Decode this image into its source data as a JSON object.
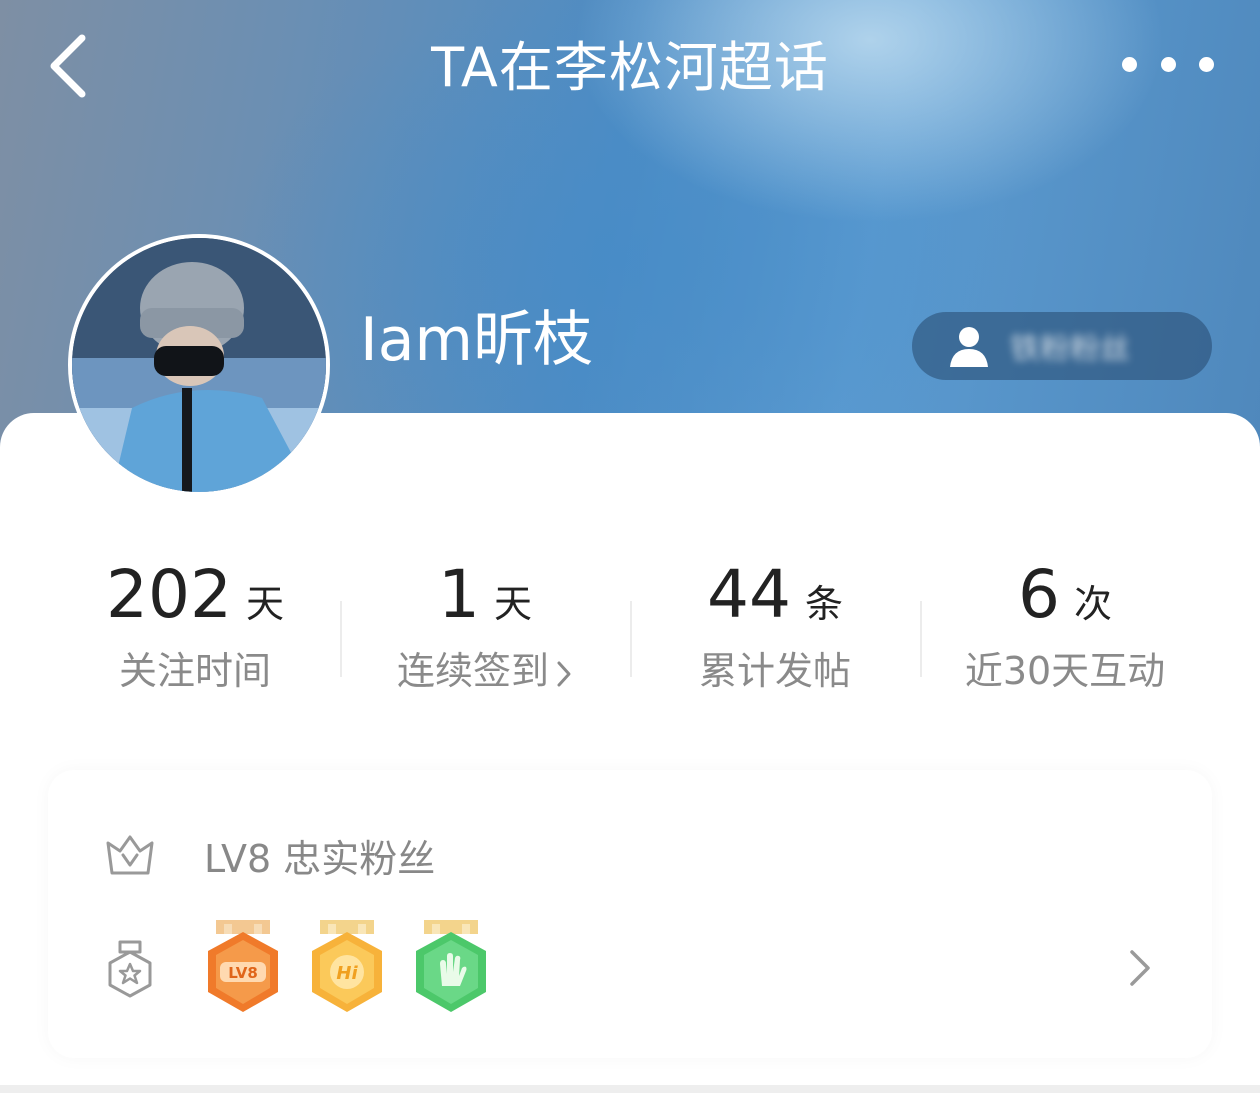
{
  "header": {
    "title": "TA在李松河超话",
    "back_icon": "chevron-left-icon",
    "more_icon": "more-dots-icon"
  },
  "profile": {
    "username": "Iam昕枝",
    "fan_pill_icon": "person-icon",
    "fan_pill_text": "铁粉粉丝"
  },
  "stats": [
    {
      "value": "202",
      "unit": "天",
      "label": "关注时间"
    },
    {
      "value": "1",
      "unit": "天",
      "label": "连续签到"
    },
    {
      "value": "44",
      "unit": "条",
      "label": "累计发帖"
    },
    {
      "value": "6",
      "unit": "次",
      "label": "近30天互动"
    }
  ],
  "level": {
    "icon": "crown-v-icon",
    "text": "LV8 忠实粉丝"
  },
  "badges": {
    "icon": "medal-star-icon",
    "items": [
      {
        "name": "lv8-badge",
        "text": "LV8",
        "color": "#f07a2a"
      },
      {
        "name": "hi-badge",
        "text": "Hi",
        "color": "#f7b23a"
      },
      {
        "name": "hand-badge",
        "text": "",
        "color": "#4cc86a"
      }
    ]
  },
  "colors": {
    "accent_text": "#222222",
    "muted_text": "#8a8a8a"
  }
}
